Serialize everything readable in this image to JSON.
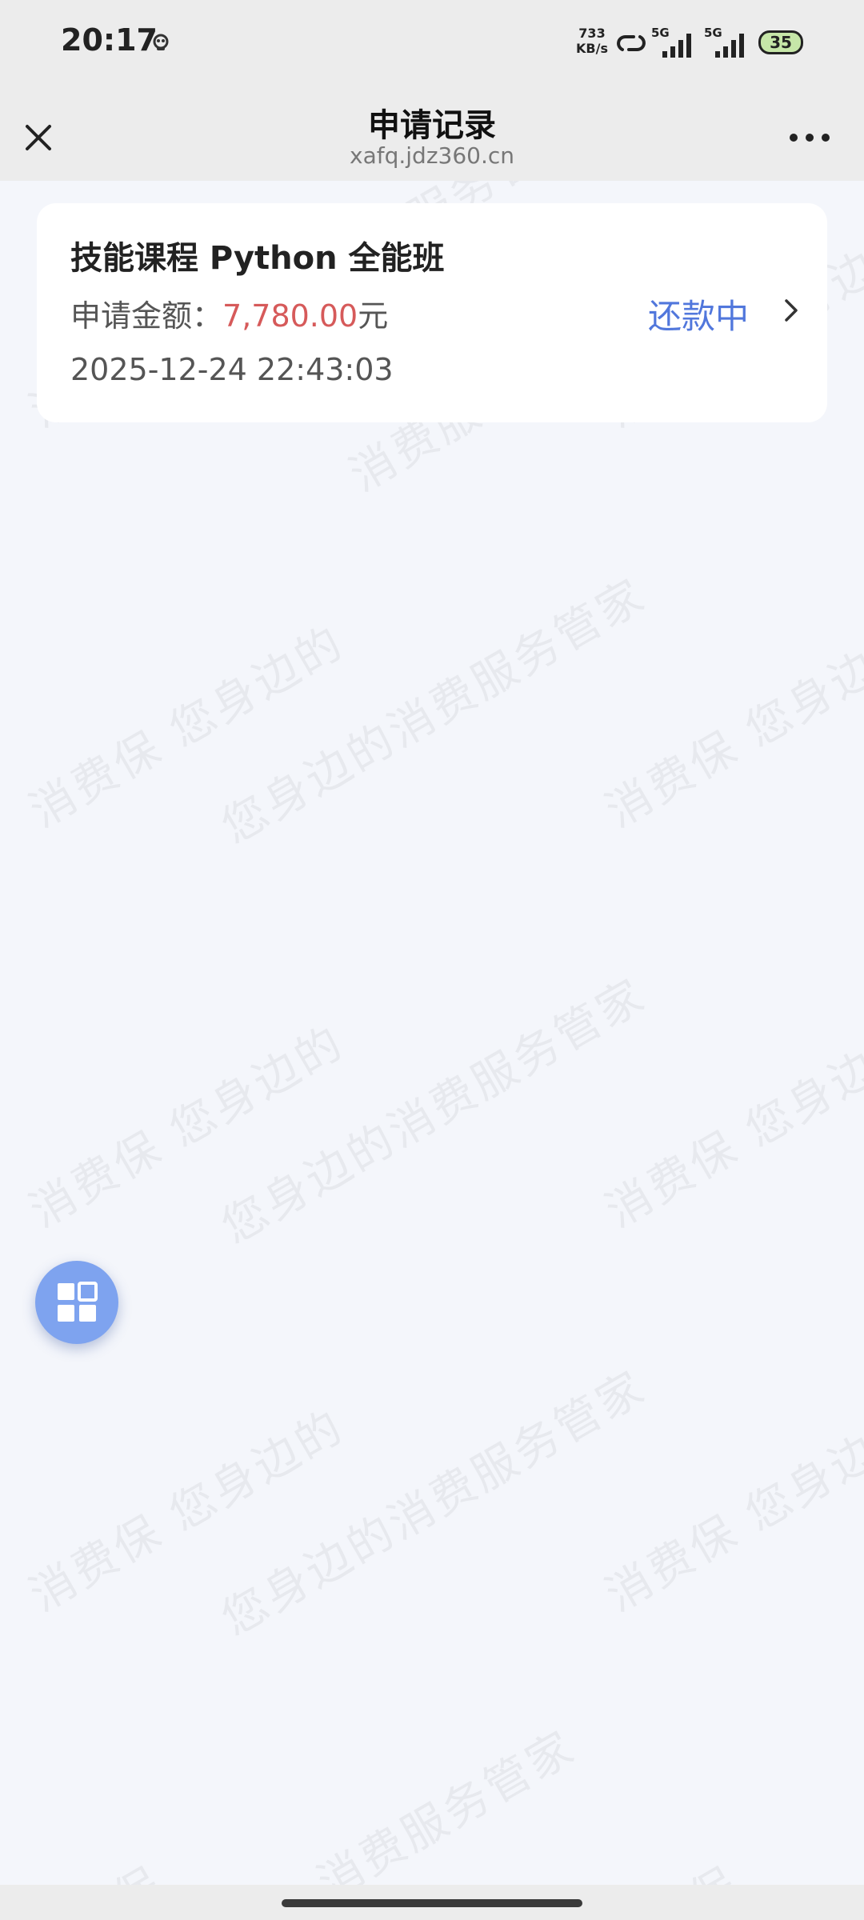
{
  "status_bar": {
    "time": "20:17",
    "speed_value": "733",
    "speed_unit": "KB/s",
    "sim1_network": "5G",
    "sim2_network": "5G",
    "battery_level": "35",
    "battery_color": "#c6e6a8"
  },
  "header": {
    "title": "申请记录",
    "url": "xafq.jdz360.cn",
    "close_icon": "close-icon",
    "more_icon": "more-horizontal-icon"
  },
  "records": [
    {
      "title": "技能课程 Python 全能班",
      "amount_label": "申请金额：",
      "amount_value": "7,780.00",
      "amount_unit": "元",
      "status": "还款中",
      "date": "2025-12-24 22:43:03"
    }
  ],
  "watermark": {
    "text_a": "消费保 您身边的",
    "text_b": "您身边的消费服务管家",
    "text_c": "消费保",
    "text_d": "消费保 您身边",
    "text_e": "消费服务管家"
  },
  "floating_button": {
    "icon": "grid-icon"
  },
  "colors": {
    "accent": "#5177dc",
    "amount": "#d65a5a",
    "fab": "#7ea3ef",
    "background": "#f4f6fb"
  }
}
